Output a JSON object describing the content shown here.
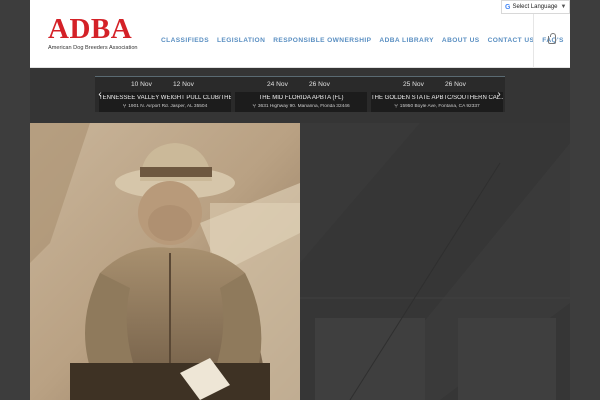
{
  "brand": {
    "mark": "ADBA",
    "subtitle": "American Dog Breeders Association",
    "color": "#d42127"
  },
  "nav": {
    "items": [
      {
        "label": "CLASSIFIEDS"
      },
      {
        "label": "LEGISLATION"
      },
      {
        "label": "RESPONSIBLE OWNERSHIP"
      },
      {
        "label": "ADBA LIBRARY"
      },
      {
        "label": "ABOUT US"
      },
      {
        "label": "CONTACT US"
      },
      {
        "label": "FAQ'S"
      }
    ],
    "color": "#5a8fc2",
    "cart_icon": "shopping-bag-icon"
  },
  "translate": {
    "icon": "G",
    "label": "Select Language",
    "caret": "▼"
  },
  "events": {
    "prev_icon": "‹",
    "next_icon": "›",
    "items": [
      {
        "start": "10 Nov",
        "end": "12 Nov",
        "title": "TENNESSEE VALLEY WEIGHT PULL CLUB/THE...",
        "address": "1901 N. Airport Rd. Jasper, AL 35504"
      },
      {
        "start": "24 Nov",
        "end": "26 Nov",
        "title": "THE MID FLORIDA APBTA (FL)",
        "address": "3631 Highway 90. Marianna, Florida 32446"
      },
      {
        "start": "25 Nov",
        "end": "26 Nov",
        "title": "THE GOLDEN STATE APBTC/SOUTHERN CAL...",
        "address": "15950 Boyle Ave, Fontana, CA 92337"
      }
    ]
  }
}
